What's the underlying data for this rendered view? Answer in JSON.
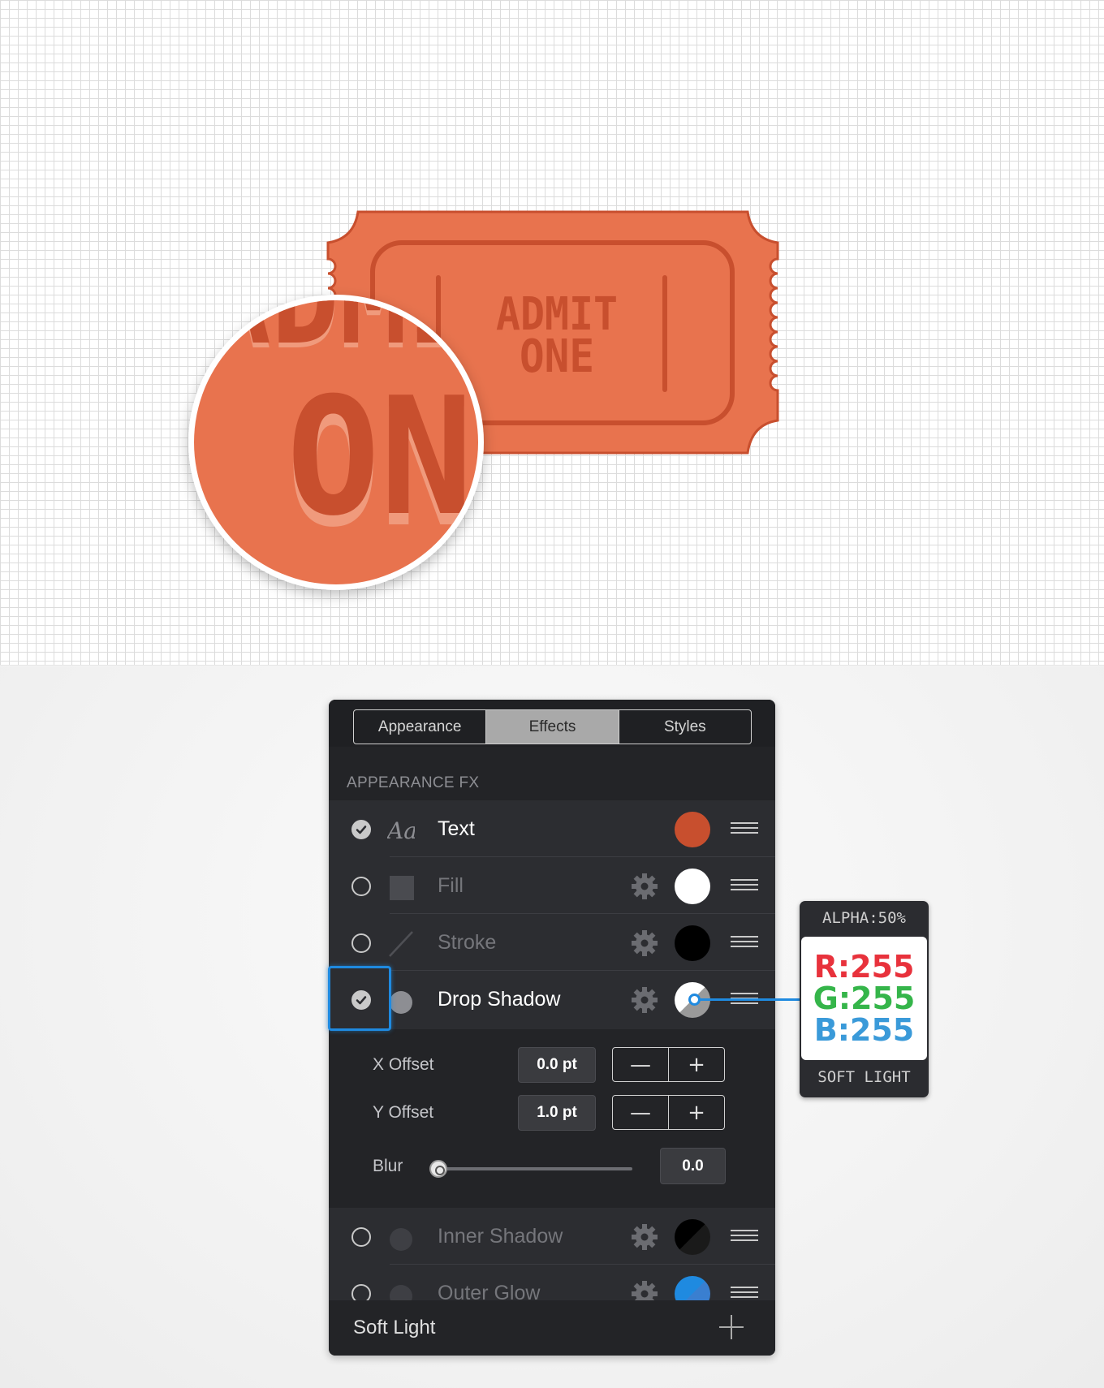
{
  "canvas": {
    "ticket": {
      "line1": "ADMIT",
      "line2": "ONE",
      "color": "#e8734e",
      "ink_color": "#c84f2e"
    },
    "magnifier": {
      "line1": "ADMIT",
      "line2": "ON"
    }
  },
  "panel": {
    "tabs": [
      {
        "label": "Appearance",
        "active": false
      },
      {
        "label": "Effects",
        "active": true
      },
      {
        "label": "Styles",
        "active": false
      }
    ],
    "section_title": "APPEARANCE FX",
    "rows": [
      {
        "label": "Text",
        "checked": true,
        "enabled": true,
        "icon": "text-aa-icon",
        "swatch": "#c84f2e"
      },
      {
        "label": "Fill",
        "checked": false,
        "enabled": false,
        "icon": "square-fill-icon",
        "swatch": "#ffffff"
      },
      {
        "label": "Stroke",
        "checked": false,
        "enabled": false,
        "icon": "stroke-line-icon",
        "swatch": "#000000"
      },
      {
        "label": "Drop Shadow",
        "checked": true,
        "enabled": true,
        "icon": "circle-shadow-icon",
        "swatch": "#ffffff"
      },
      {
        "label": "Inner Shadow",
        "checked": false,
        "enabled": false,
        "icon": "circle-shadow-icon",
        "swatch": "#000000"
      },
      {
        "label": "Outer Glow",
        "checked": false,
        "enabled": false,
        "icon": "circle-glow-icon",
        "swatch": "#1f8ae0"
      }
    ],
    "shadow_settings": {
      "x_offset_label": "X Offset",
      "x_offset_value": "0.0 pt",
      "y_offset_label": "Y Offset",
      "y_offset_value": "1.0 pt",
      "blur_label": "Blur",
      "blur_value": "0.0",
      "blur_level": 0
    },
    "footer": {
      "blend_mode": "Soft Light"
    }
  },
  "callout": {
    "alpha": "ALPHA:50%",
    "r": "R:255",
    "g": "G:255",
    "b": "B:255",
    "blend": "SOFT LIGHT"
  }
}
